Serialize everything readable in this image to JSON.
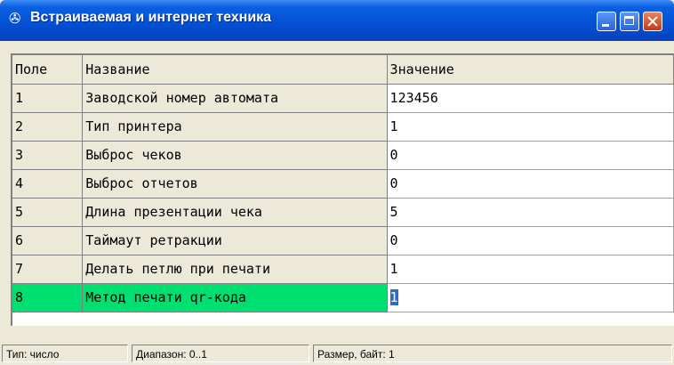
{
  "window": {
    "title": "Встраиваемая и интернет техника",
    "app_icon": "✇"
  },
  "grid": {
    "columns": [
      "Поле",
      "Название",
      "Значение"
    ],
    "rows": [
      {
        "field": "1",
        "name": "Заводской номер автомата",
        "value": "123456"
      },
      {
        "field": "2",
        "name": "Тип принтера",
        "value": "1"
      },
      {
        "field": "3",
        "name": "Выброс чеков",
        "value": "0"
      },
      {
        "field": "4",
        "name": "Выброс отчетов",
        "value": "0"
      },
      {
        "field": "5",
        "name": "Длина презентации чека",
        "value": "5"
      },
      {
        "field": "6",
        "name": "Таймаут ретракции",
        "value": "0"
      },
      {
        "field": "7",
        "name": "Делать петлю при печати",
        "value": "1"
      },
      {
        "field": "8",
        "name": "Метод печати qr-кода",
        "value": "1"
      }
    ],
    "selected_row_color": "#00e070"
  },
  "status": {
    "type": "Тип: число",
    "range": "Диапазон: 0..1",
    "size": "Размер, байт: 1"
  }
}
